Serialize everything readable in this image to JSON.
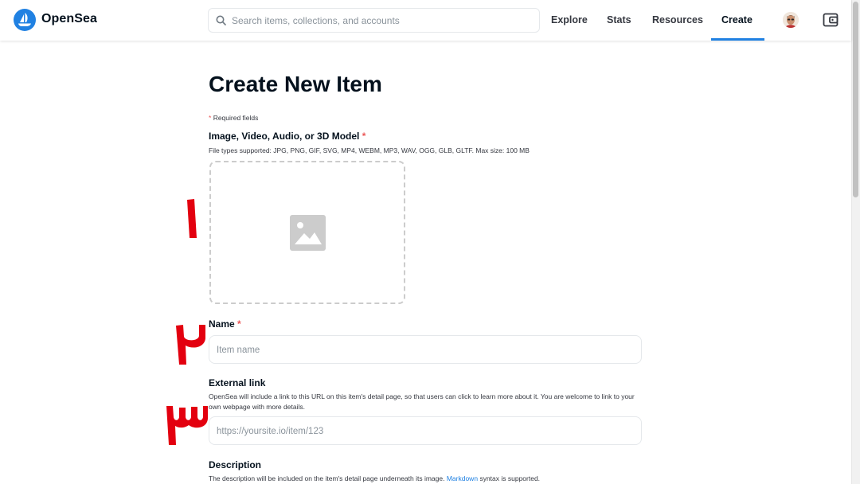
{
  "header": {
    "brand": "OpenSea",
    "search_placeholder": "Search items, collections, and accounts",
    "nav": [
      {
        "label": "Explore"
      },
      {
        "label": "Stats"
      },
      {
        "label": "Resources"
      },
      {
        "label": "Create",
        "active": true
      }
    ],
    "icons": {
      "logo": "opensea-logo-icon",
      "search": "search-icon",
      "avatar": "user-avatar",
      "wallet": "wallet-icon"
    }
  },
  "form": {
    "title": "Create New Item",
    "required_marker": "*",
    "required_note": "Required fields",
    "media": {
      "label": "Image, Video, Audio, or 3D Model",
      "help": "File types supported: JPG, PNG, GIF, SVG, MP4, WEBM, MP3, WAV, OGG, GLB, GLTF. Max size: 100 MB",
      "placeholder_icon": "image-placeholder-icon"
    },
    "name": {
      "label": "Name",
      "placeholder": "Item name"
    },
    "external_link": {
      "label": "External link",
      "help": "OpenSea will include a link to this URL on this item's detail page, so that users can click to learn more about it. You are welcome to link to your own webpage with more details.",
      "placeholder": "https://yoursite.io/item/123"
    },
    "description": {
      "label": "Description",
      "help_before": "The description will be included on the item's detail page underneath its image.",
      "help_link": "Markdown",
      "help_after": "syntax is supported."
    }
  },
  "annotations": {
    "color": "#e3000f",
    "markers": [
      "۱",
      "۲",
      "۳"
    ]
  },
  "colors": {
    "accent": "#2081e2",
    "required": "#eb5757",
    "text": "#04111d"
  }
}
